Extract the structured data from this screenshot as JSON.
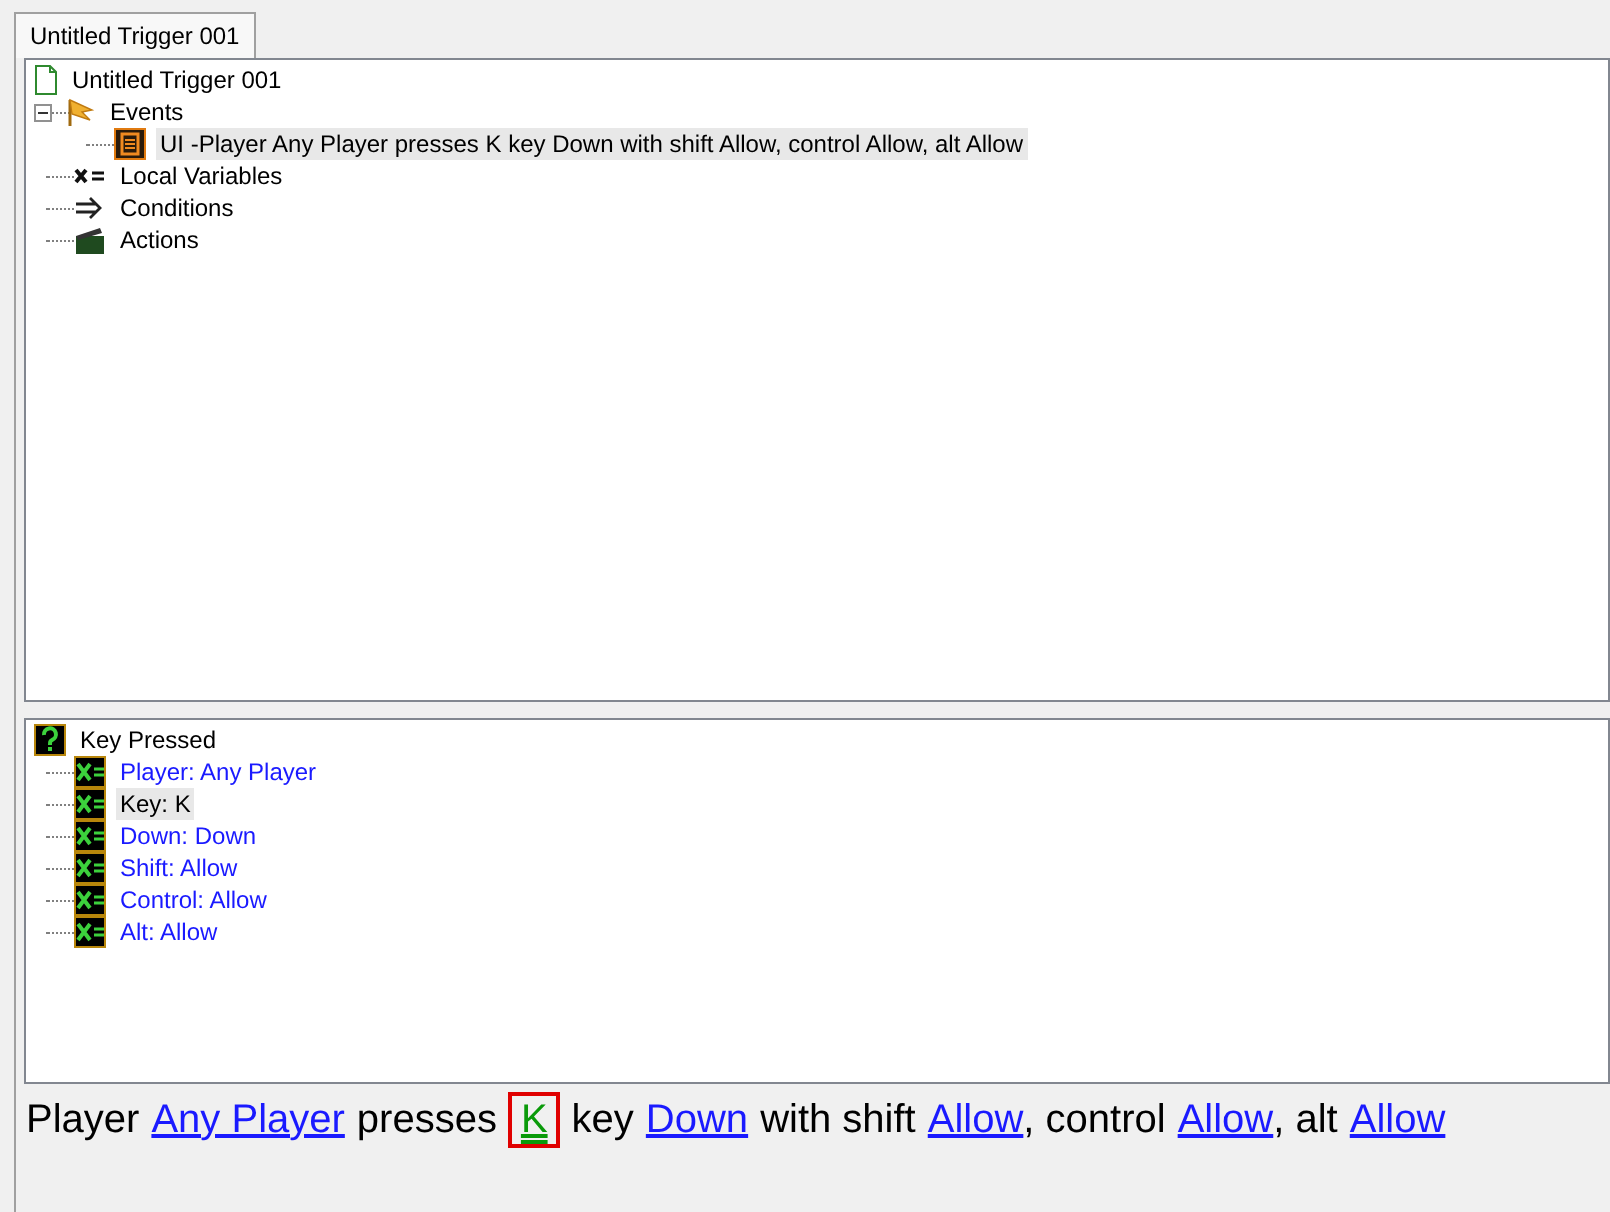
{
  "tabs": [
    {
      "label": "Untitled Trigger 001",
      "selected": true
    }
  ],
  "trigger_tree": [
    {
      "label": "Untitled Trigger 001",
      "kind": "document",
      "selected": false,
      "children": [
        {
          "label": "Events",
          "kind": "flag",
          "selected": false,
          "expanded": true,
          "children": [
            {
              "label": "UI -Player Any Player presses K key Down with shift Allow, control Allow, alt Allow",
              "kind": "event",
              "selected": true
            }
          ]
        },
        {
          "label": "Local Variables",
          "kind": "variable",
          "selected": false
        },
        {
          "label": "Conditions",
          "kind": "condition",
          "selected": false
        },
        {
          "label": "Actions",
          "kind": "action",
          "selected": false
        }
      ]
    }
  ],
  "parameter_tree": [
    {
      "label": "Key Pressed",
      "kind": "function",
      "selected": false,
      "children": [
        {
          "label": "Player: Any Player",
          "kind": "parameter",
          "selected": false
        },
        {
          "label": "Key: K",
          "kind": "parameter",
          "selected": true
        },
        {
          "label": "Down: Down",
          "kind": "parameter",
          "selected": false
        },
        {
          "label": "Shift: Allow",
          "kind": "parameter",
          "selected": false
        },
        {
          "label": "Control: Allow",
          "kind": "parameter",
          "selected": false
        },
        {
          "label": "Alt: Allow",
          "kind": "parameter",
          "selected": false
        }
      ]
    }
  ],
  "phrase": [
    {
      "kind": "text",
      "text": "Player"
    },
    {
      "kind": "link",
      "text": "Any Player",
      "selected": false
    },
    {
      "kind": "text",
      "text": "presses"
    },
    {
      "kind": "link",
      "text": "K",
      "selected": true
    },
    {
      "kind": "text",
      "text": "key"
    },
    {
      "kind": "link",
      "text": "Down",
      "selected": false
    },
    {
      "kind": "text",
      "text": "with shift"
    },
    {
      "kind": "link",
      "text": "Allow",
      "selected": false
    },
    {
      "kind": "text",
      "text": ", control"
    },
    {
      "kind": "link",
      "text": "Allow",
      "selected": false
    },
    {
      "kind": "text",
      "text": ", alt"
    },
    {
      "kind": "link",
      "text": "Allow",
      "selected": false
    }
  ]
}
